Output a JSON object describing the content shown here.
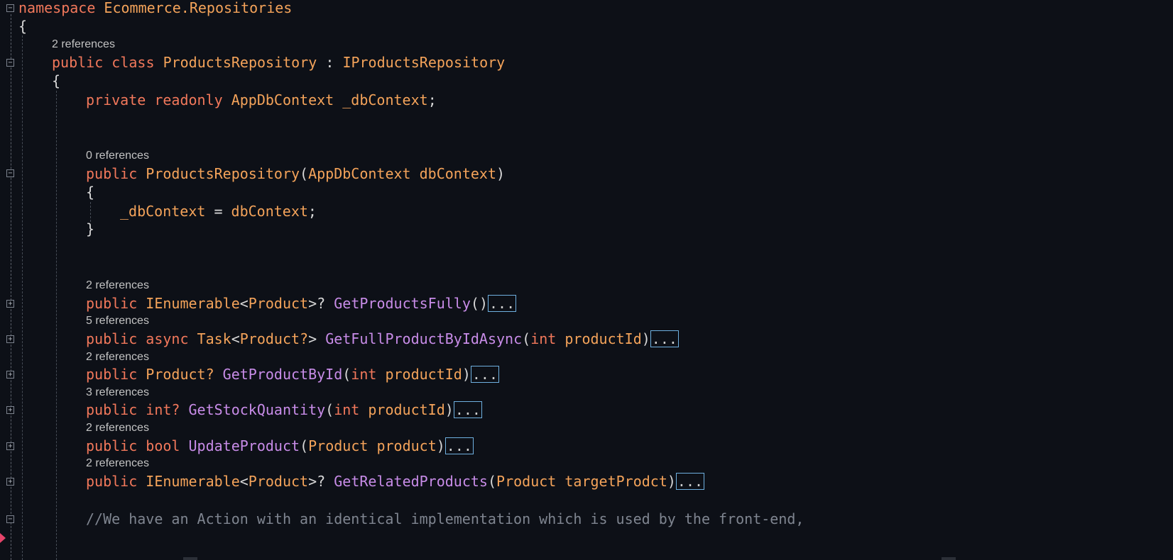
{
  "editor": {
    "namespace_line": {
      "kw": "namespace",
      "name": "Ecommerce.Repositories"
    },
    "open_brace_1": "{",
    "class_refs": "2 references",
    "class_line": {
      "mod": "public",
      "kw": "class",
      "name": "ProductsRepository",
      "sep": " : ",
      "iface": "IProductsRepository"
    },
    "open_brace_2": "{",
    "field_line": {
      "mod": "private",
      "kw": "readonly",
      "type": "AppDbContext",
      "name": "_dbContext",
      "end": ";"
    },
    "ctor_refs": "0 references",
    "ctor_line": {
      "mod": "public",
      "name": "ProductsRepository",
      "p1": "(",
      "ptype": "AppDbContext",
      "pname": "dbContext",
      "p2": ")"
    },
    "ctor_open": "{",
    "ctor_body": {
      "lhs": "_dbContext",
      "op": " = ",
      "rhs": "dbContext",
      "end": ";"
    },
    "ctor_close": "}",
    "methods": [
      {
        "refs": "2 references",
        "mod": "public",
        "ret": "IEnumerable",
        "lt": "<",
        "gen": "Product",
        "gt": ">?",
        "name": "GetProductsFully",
        "params_open": "(",
        "ptype": "",
        "pname": "",
        "params_close": ")",
        "collapsed": "..."
      },
      {
        "refs": "5 references",
        "mod": "public async",
        "ret": "Task",
        "lt": "<",
        "gen": "Product?",
        "gt": ">",
        "name": "GetFullProductByIdAsync",
        "params_open": "(",
        "ptype": "int",
        "pname": "productId",
        "params_close": ")",
        "collapsed": "..."
      },
      {
        "refs": "2 references",
        "mod": "public",
        "ret": "Product?",
        "lt": "",
        "gen": "",
        "gt": "",
        "name": "GetProductById",
        "params_open": "(",
        "ptype": "int",
        "pname": "productId",
        "params_close": ")",
        "collapsed": "..."
      },
      {
        "refs": "3 references",
        "mod": "public",
        "ret": "int?",
        "lt": "",
        "gen": "",
        "gt": "",
        "name": "GetStockQuantity",
        "params_open": "(",
        "ptype": "int",
        "pname": "productId",
        "params_close": ")",
        "collapsed": "..."
      },
      {
        "refs": "2 references",
        "mod": "public",
        "ret": "bool",
        "lt": "",
        "gen": "",
        "gt": "",
        "name": "UpdateProduct",
        "params_open": "(",
        "ptype": "Product",
        "pname": "product",
        "params_close": ")",
        "collapsed": "..."
      },
      {
        "refs": "2 references",
        "mod": "public",
        "ret": "IEnumerable",
        "lt": "<",
        "gen": "Product",
        "gt": ">?",
        "name": "GetRelatedProducts",
        "params_open": "(",
        "ptype": "Product",
        "pname": "targetProdct",
        "params_close": ")",
        "collapsed": "..."
      }
    ],
    "comment": "//We have an Action with an identical implementation which is used by the front-end,"
  },
  "colors": {
    "background": "#0d1017",
    "keyword": "#f2785b",
    "type": "#f4a35a",
    "method": "#c88ce8",
    "comment": "#7f8590",
    "collapsed_border": "#6fb0e0"
  }
}
